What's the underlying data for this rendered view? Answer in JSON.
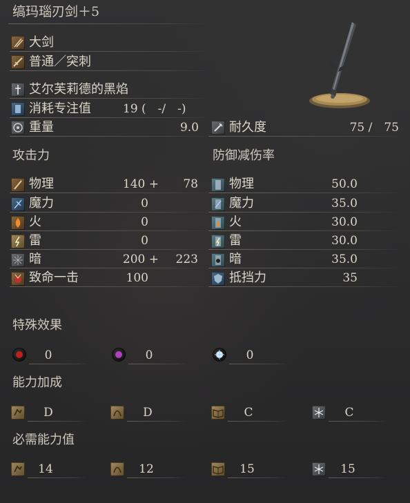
{
  "weapon": {
    "name": "缟玛瑙刃剑＋5",
    "type": "大剑",
    "attack_type": "普通／突刺",
    "skill": "艾尔芙莉德的黑焰",
    "fp_label": "消耗专注值",
    "fp_value": "19 (　-/　-)",
    "weight_label": "重量",
    "weight_value": "9.0",
    "durability_label": "耐久度",
    "durability_value": "75 /　75"
  },
  "attack": {
    "header": "攻击力",
    "rows": [
      {
        "label": "物理",
        "value": "140 +",
        "bonus": "78"
      },
      {
        "label": "魔力",
        "value": "0",
        "bonus": ""
      },
      {
        "label": "火",
        "value": "0",
        "bonus": ""
      },
      {
        "label": "雷",
        "value": "0",
        "bonus": ""
      },
      {
        "label": "暗",
        "value": "200 +",
        "bonus": "223"
      },
      {
        "label": "致命一击",
        "value": "100",
        "bonus": ""
      }
    ]
  },
  "defense": {
    "header": "防御减伤率",
    "rows": [
      {
        "label": "物理",
        "value": "50.0"
      },
      {
        "label": "魔力",
        "value": "35.0"
      },
      {
        "label": "火",
        "value": "30.0"
      },
      {
        "label": "雷",
        "value": "30.0"
      },
      {
        "label": "暗",
        "value": "35.0"
      },
      {
        "label": "抵挡力",
        "value": "35"
      }
    ]
  },
  "effects": {
    "header": "特殊效果",
    "items": [
      {
        "icon": "bleed-icon",
        "value": "0"
      },
      {
        "icon": "poison-icon",
        "value": "0"
      },
      {
        "icon": "frost-icon",
        "value": "0"
      }
    ]
  },
  "scaling": {
    "header": "能力加成",
    "items": [
      {
        "icon": "strength-icon",
        "value": "D"
      },
      {
        "icon": "dexterity-icon",
        "value": "D"
      },
      {
        "icon": "intelligence-icon",
        "value": "C"
      },
      {
        "icon": "faith-icon",
        "value": "C"
      }
    ]
  },
  "requirements": {
    "header": "必需能力值",
    "items": [
      {
        "icon": "strength-icon",
        "value": "14"
      },
      {
        "icon": "dexterity-icon",
        "value": "12"
      },
      {
        "icon": "intelligence-icon",
        "value": "15"
      },
      {
        "icon": "faith-icon",
        "value": "15"
      }
    ]
  },
  "colors": {
    "text": "#dcd6c8",
    "background": "#2a2a2b",
    "underline": "#968c78"
  }
}
